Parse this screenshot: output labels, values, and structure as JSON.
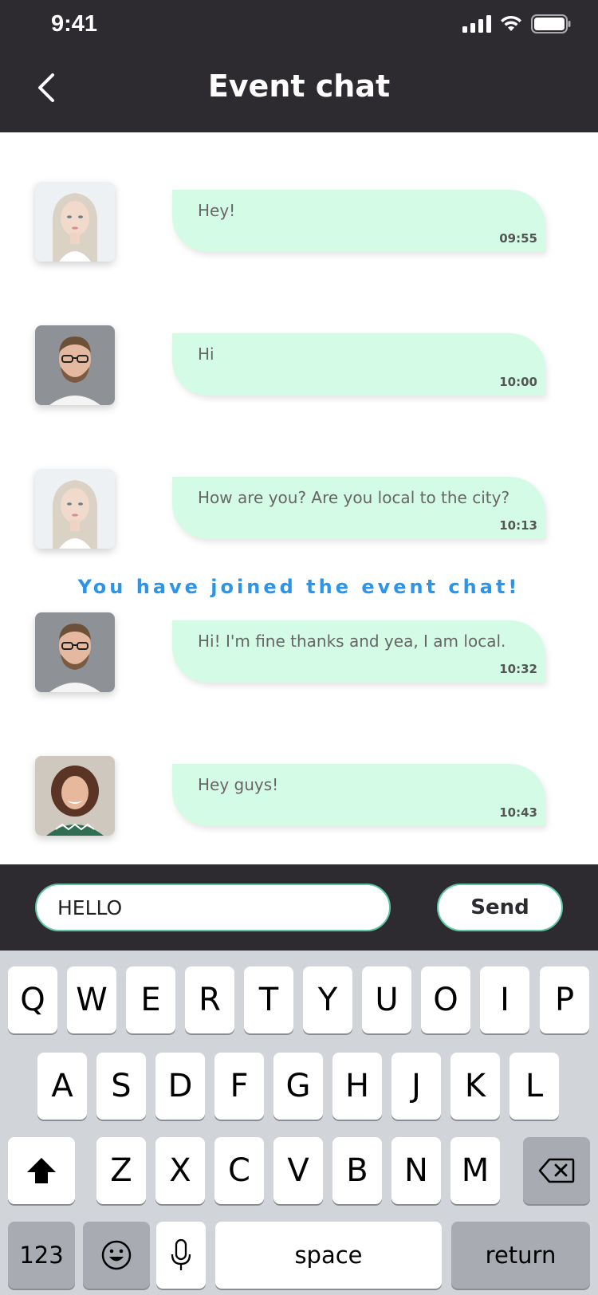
{
  "status_bar": {
    "time": "9:41"
  },
  "header": {
    "title": "Event chat"
  },
  "messages": [
    {
      "text": "Hey!",
      "time": "09:55",
      "avatar": "blonde-woman-avatar"
    },
    {
      "text": "Hi",
      "time": "10:00",
      "avatar": "man-glasses-avatar"
    },
    {
      "text": "How are you? Are you local to the city?",
      "time": "10:13",
      "avatar": "blonde-woman-avatar"
    },
    {
      "text": "Hi! I'm fine thanks and yea, I am local.",
      "time": "10:32",
      "avatar": "man-glasses-avatar"
    },
    {
      "text": "Hey guys!",
      "time": "10:43",
      "avatar": "curly-woman-avatar"
    }
  ],
  "notice": "You have joined the event chat!",
  "composer": {
    "value": "HELLO",
    "send_label": "Send"
  },
  "keyboard": {
    "row1": [
      "Q",
      "W",
      "E",
      "R",
      "T",
      "Y",
      "U",
      "O",
      "I",
      "P"
    ],
    "row2": [
      "A",
      "S",
      "D",
      "F",
      "G",
      "H",
      "J",
      "K",
      "L"
    ],
    "row3": [
      "Z",
      "X",
      "C",
      "V",
      "B",
      "N",
      "M"
    ],
    "numbers_label": "123",
    "space_label": "space",
    "return_label": "return"
  },
  "colors": {
    "header_bg": "#2d2b30",
    "bubble_bg": "#d4fbe6",
    "accent_border": "#5bc6a0",
    "notice_text": "#2b95e9"
  }
}
